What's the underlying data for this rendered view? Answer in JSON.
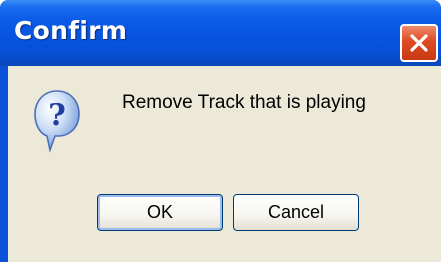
{
  "dialog": {
    "title": "Confirm",
    "message": "Remove Track that is playing",
    "icon": "question-icon",
    "buttons": {
      "ok_label": "OK",
      "cancel_label": "Cancel"
    }
  },
  "colors": {
    "titlebar": "#0854e0",
    "close_button": "#dd4b22",
    "dialog_background": "#ece9d8"
  }
}
